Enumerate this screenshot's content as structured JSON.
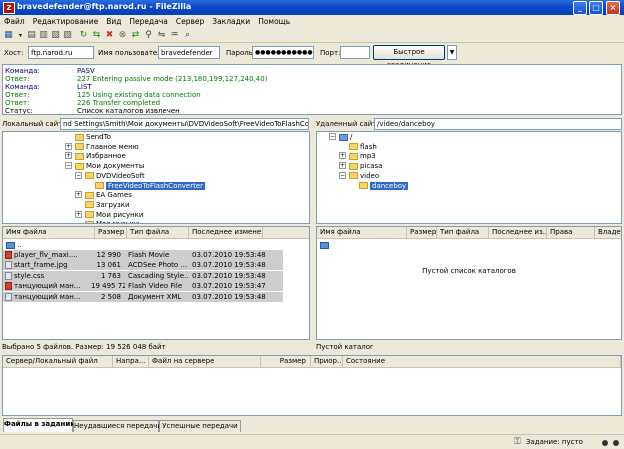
{
  "window": {
    "title": "bravedefender@ftp.narod.ru - FileZilla",
    "app_icon_letter": "Z"
  },
  "menu": [
    "Файл",
    "Редактирование",
    "Вид",
    "Передача",
    "Сервер",
    "Закладки",
    "Помощь"
  ],
  "quickconnect": {
    "host_label": "Хост:",
    "host_value": "ftp.narod.ru",
    "user_label": "Имя пользователя:",
    "user_value": "bravedefender",
    "pass_label": "Пароль:",
    "pass_value": "●●●●●●●●●●●●●",
    "port_label": "Порт:",
    "port_value": "",
    "connect_button": "Быстрое соединение",
    "dropdown_glyph": "▼"
  },
  "log": [
    {
      "kind": "Команда:",
      "text": "PASV",
      "color": "#000080"
    },
    {
      "kind": "Ответ:",
      "text": "227 Entering passive mode (213,180,199,127,240,40)",
      "color": "#008000"
    },
    {
      "kind": "Команда:",
      "text": "LIST",
      "color": "#000080"
    },
    {
      "kind": "Ответ:",
      "text": "125 Using existing data connection",
      "color": "#008000"
    },
    {
      "kind": "Ответ:",
      "text": "226 Transfer completed",
      "color": "#008000"
    },
    {
      "kind": "Статус:",
      "text": "Список каталогов извлечен",
      "color": "#000000"
    }
  ],
  "local": {
    "site_label": "Локальный сайт:",
    "path": "nd Settings\\Smith\\Мои документы\\DVDVideoSoft\\FreeVideoToFlashConverter\\",
    "tree": [
      {
        "label": "SendTo",
        "depth": 0,
        "exp": ""
      },
      {
        "label": "Главное меню",
        "depth": 0,
        "exp": "+"
      },
      {
        "label": "Избранное",
        "depth": 0,
        "exp": "+"
      },
      {
        "label": "Мои документы",
        "depth": 0,
        "exp": "−"
      },
      {
        "label": "DVDVideoSoft",
        "depth": 1,
        "exp": "−"
      },
      {
        "label": "FreeVideoToFlashConverter",
        "depth": 2,
        "exp": "",
        "selected": true
      },
      {
        "label": "EA Games",
        "depth": 1,
        "exp": "+"
      },
      {
        "label": "Загрузки",
        "depth": 1,
        "exp": ""
      },
      {
        "label": "Мои рисунки",
        "depth": 1,
        "exp": "+"
      },
      {
        "label": "Моя музыка",
        "depth": 1,
        "exp": ""
      }
    ],
    "columns": [
      "Имя файла",
      "Размер",
      "Тип файла",
      "Последнее измене..."
    ],
    "parent_row": "..",
    "files": [
      {
        "name": "player_flv_maxi....",
        "size": "12 990",
        "type": "Flash Movie",
        "date": "03.07.2010 19:53:48",
        "icon": "red"
      },
      {
        "name": "start_frame.jpg",
        "size": "13 061",
        "type": "ACDSee Photo ...",
        "date": "03.07.2010 19:53:48",
        "icon": "doc"
      },
      {
        "name": "style.css",
        "size": "1 763",
        "type": "Cascading Style...",
        "date": "03.07.2010 19:53:48",
        "icon": "doc"
      },
      {
        "name": "танцующий ман...",
        "size": "19 495 726",
        "type": "Flash Video File",
        "date": "03.07.2010 19:53:47",
        "icon": "red"
      },
      {
        "name": "танцующий ман...",
        "size": "2 508",
        "type": "Документ XML",
        "date": "03.07.2010 19:53:48",
        "icon": "doc"
      }
    ],
    "status": "Выбрано 5 файлов. Размер: 19 526 048 байт"
  },
  "remote": {
    "site_label": "Удаленный сайт:",
    "path": "/video/danceboy",
    "tree": [
      {
        "label": "/",
        "depth": 0,
        "exp": "−"
      },
      {
        "label": "flash",
        "depth": 1,
        "exp": ""
      },
      {
        "label": "mp3",
        "depth": 1,
        "exp": "+"
      },
      {
        "label": "picasa",
        "depth": 1,
        "exp": "+"
      },
      {
        "label": "video",
        "depth": 1,
        "exp": "−"
      },
      {
        "label": "danceboy",
        "depth": 2,
        "exp": "",
        "selected": true
      }
    ],
    "columns": [
      "Имя файла",
      "Размер",
      "Тип файла",
      "Последнее из...",
      "Права",
      "Владел"
    ],
    "empty_text": "Пустой список каталогов",
    "status": "Пустой каталог"
  },
  "queue": {
    "columns": [
      "Сервер/Локальный файл",
      "Напра...",
      "Файл на сервере",
      "Размер",
      "Приор...",
      "Состояние"
    ]
  },
  "tabs": [
    "Файлы в задании",
    "Неудавшиеся передачи",
    "Успешные передачи"
  ],
  "statusbar": {
    "queue_text": "Задание: пусто"
  }
}
